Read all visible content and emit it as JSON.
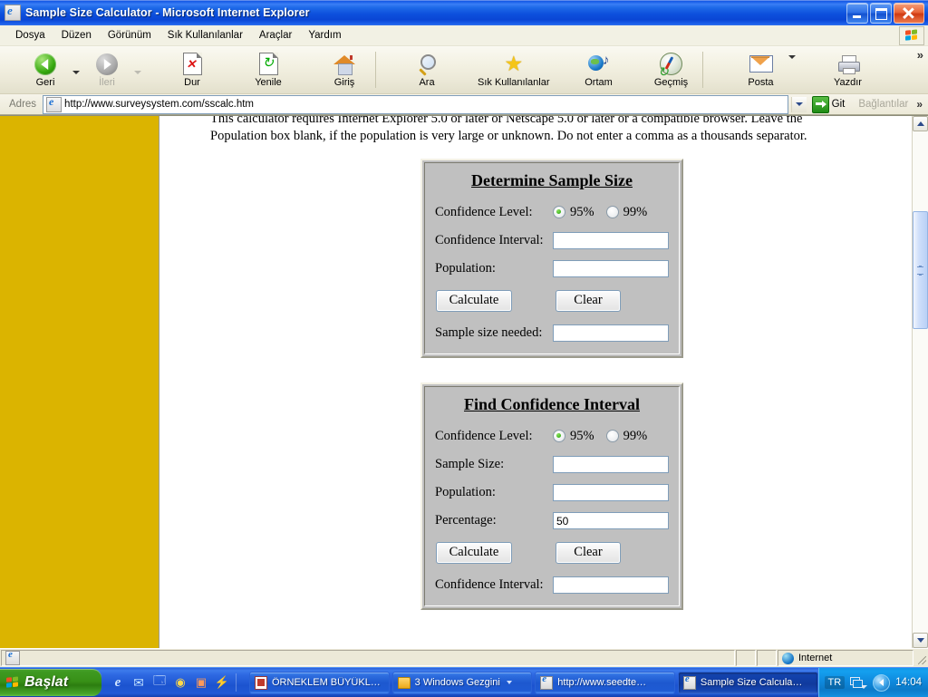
{
  "window": {
    "title": "Sample Size Calculator - Microsoft Internet Explorer",
    "title_icon": "ie-document-icon",
    "buttons": {
      "minimize": "Simge Durumuna Küçült",
      "maximize": "Ekranı Kapla",
      "close": "Kapat"
    }
  },
  "menubar": {
    "items": [
      {
        "label": "Dosya"
      },
      {
        "label": "Düzen"
      },
      {
        "label": "Görünüm"
      },
      {
        "label": "Sık Kullanılanlar"
      },
      {
        "label": "Araçlar"
      },
      {
        "label": "Yardım"
      }
    ],
    "logo": "windows-flag-logo"
  },
  "toolbar": {
    "overflow_chevron": "»",
    "items": [
      {
        "label": "Geri",
        "icon": "back-arrow-icon",
        "disabled": false,
        "has_caret": true
      },
      {
        "label": "İleri",
        "icon": "forward-arrow-icon",
        "disabled": true,
        "has_caret": true
      },
      {
        "label": "Dur",
        "icon": "stop-icon",
        "disabled": false
      },
      {
        "label": "Yenile",
        "icon": "refresh-icon",
        "disabled": false
      },
      {
        "label": "Giriş",
        "icon": "home-icon",
        "disabled": false
      },
      {
        "label": "Ara",
        "icon": "search-magnifier-icon",
        "disabled": false
      },
      {
        "label": "Sık Kullanılanlar",
        "icon": "star-favorites-icon",
        "disabled": false
      },
      {
        "label": "Ortam",
        "icon": "media-globe-icon",
        "disabled": false
      },
      {
        "label": "Geçmiş",
        "icon": "history-compass-icon",
        "disabled": false
      },
      {
        "label": "Posta",
        "icon": "mail-envelope-icon",
        "disabled": false,
        "has_caret": true
      },
      {
        "label": "Yazdır",
        "icon": "printer-icon",
        "disabled": false
      }
    ]
  },
  "address_bar": {
    "label": "Adres",
    "url": "http://www.surveysystem.com/sscalc.htm",
    "go_label": "Git",
    "links_label": "Bağlantılar",
    "chevron": "»"
  },
  "page": {
    "intro_line1": "This calculator requires Internet Explorer 5.0 or later or Netscape 5.0 or later or a compatible browser. Leave the",
    "intro_line2": "Population box blank, if the population is very large or unknown. Do not enter a comma as a thousands separator.",
    "sidebar_color": "#dbb400",
    "panels": [
      {
        "title": "Determine Sample Size",
        "confidence_label": "Confidence Level:",
        "radio_95": "95%",
        "radio_99": "99%",
        "radio_selected": "95%",
        "fields": [
          {
            "label": "Confidence Interval:",
            "value": ""
          },
          {
            "label": "Population:",
            "value": ""
          }
        ],
        "calculate_label": "Calculate",
        "clear_label": "Clear",
        "result_label": "Sample size needed:",
        "result_value": ""
      },
      {
        "title": "Find Confidence Interval",
        "confidence_label": "Confidence Level:",
        "radio_95": "95%",
        "radio_99": "99%",
        "radio_selected": "95%",
        "fields": [
          {
            "label": "Sample Size:",
            "value": ""
          },
          {
            "label": "Population:",
            "value": ""
          },
          {
            "label": "Percentage:",
            "value": "50"
          }
        ],
        "calculate_label": "Calculate",
        "clear_label": "Clear",
        "result_label": "Confidence Interval:",
        "result_value": ""
      }
    ]
  },
  "statusbar": {
    "message": "",
    "zone": "Internet",
    "zone_icon": "globe-icon"
  },
  "taskbar": {
    "start_label": "Başlat",
    "quicklaunch": [
      {
        "icon": "ie-launch-icon"
      },
      {
        "icon": "outlook-express-icon"
      },
      {
        "icon": "show-desktop-icon"
      },
      {
        "icon": "clock-icon"
      },
      {
        "icon": "media-player-icon"
      },
      {
        "icon": "winamp-icon"
      }
    ],
    "tasks": [
      {
        "label": "ÖRNEKLEM BÜYÜKL…",
        "icon": "word-document-icon",
        "active": false,
        "has_caret": false
      },
      {
        "label": "3 Windows Gezgini",
        "icon": "folder-icon",
        "active": false,
        "has_caret": true
      },
      {
        "label": "http://www.seedte…",
        "icon": "ie-window-icon",
        "active": false,
        "has_caret": false
      },
      {
        "label": "Sample Size Calcula…",
        "icon": "ie-window-icon",
        "active": true,
        "has_caret": false
      }
    ],
    "tray": {
      "language": "TR",
      "network_icon": "network-connections-icon",
      "volume_icon": "volume-icon",
      "clock": "14:04"
    }
  }
}
